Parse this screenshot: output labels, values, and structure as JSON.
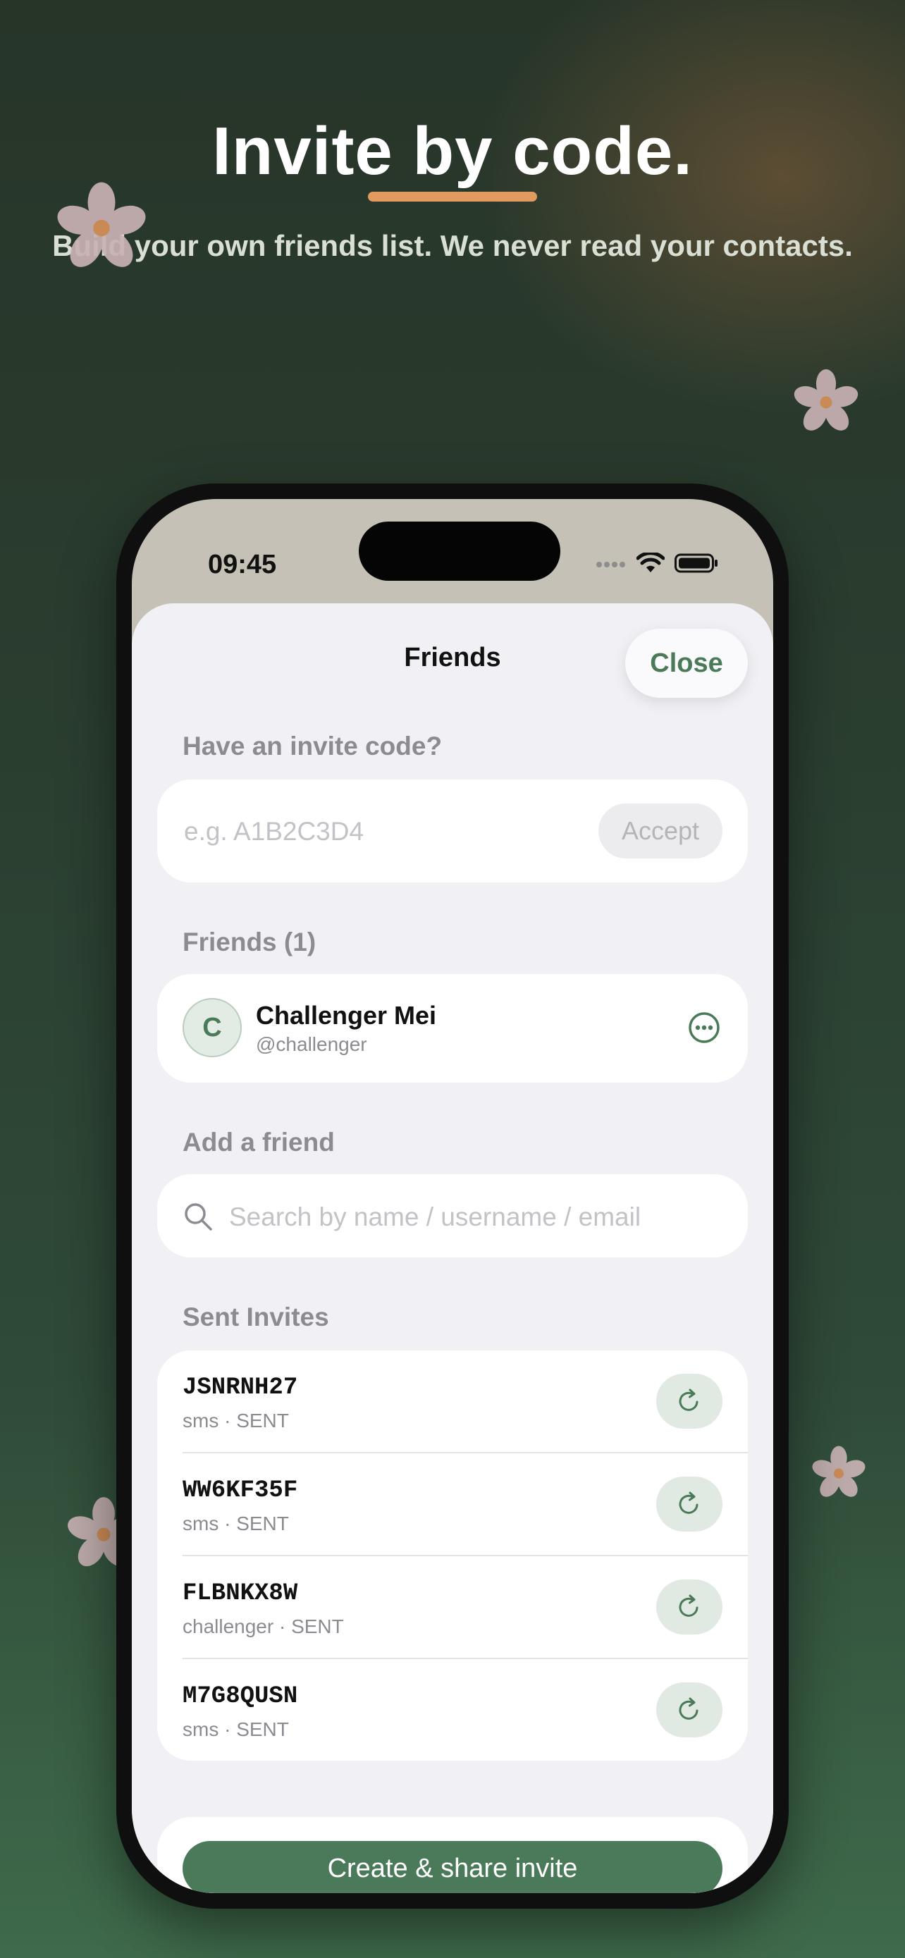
{
  "promo": {
    "headline": "Invite by code.",
    "subheadline": "Build your own friends list. We never read your contacts.",
    "accent_color": "#e39a5f"
  },
  "status_bar": {
    "time": "09:45",
    "icons": [
      "signal-dots-icon",
      "wifi-icon",
      "battery-icon"
    ]
  },
  "sheet": {
    "title": "Friends",
    "close_label": "Close"
  },
  "invite_code": {
    "section_label": "Have an invite code?",
    "placeholder": "e.g. A1B2C3D4",
    "value": "",
    "accept_label": "Accept"
  },
  "friends": {
    "section_label": "Friends (1)",
    "items": [
      {
        "initial": "C",
        "name": "Challenger Mei",
        "handle": "@challenger"
      }
    ]
  },
  "add_friend": {
    "section_label": "Add a friend",
    "search_placeholder": "Search by name / username / email"
  },
  "sent_invites": {
    "section_label": "Sent Invites",
    "items": [
      {
        "code": "JSNRNH27",
        "meta": "sms · SENT"
      },
      {
        "code": "WW6KF35F",
        "meta": "sms · SENT"
      },
      {
        "code": "FLBNKX8W",
        "meta": "challenger · SENT"
      },
      {
        "code": "M7G8QUSN",
        "meta": "sms · SENT"
      }
    ]
  },
  "create_button_label": "Create & share invite",
  "colors": {
    "brand_green": "#4b7a5a",
    "sheet_bg": "#f1f1f5"
  }
}
